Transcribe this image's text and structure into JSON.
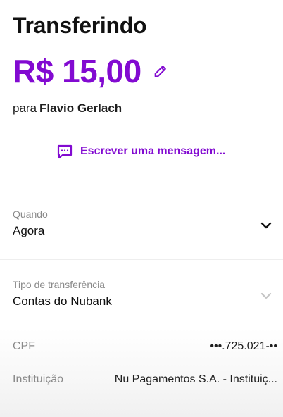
{
  "header": {
    "title": "Transferindo"
  },
  "transfer": {
    "amount": "R$ 15,00",
    "recipient_prefix": "para",
    "recipient_name": "Flavio Gerlach",
    "message_label": "Escrever uma mensagem..."
  },
  "when": {
    "label": "Quando",
    "value": "Agora"
  },
  "transfer_type": {
    "label": "Tipo de transferência",
    "value": "Contas do Nubank"
  },
  "details": {
    "cpf_label": "CPF",
    "cpf_value": "•••.725.021-••",
    "institution_label": "Instituição",
    "institution_value": "Nu Pagamentos S.A. - Instituiç..."
  },
  "icons": {
    "edit": "pencil-icon",
    "message": "chat-icon",
    "chevron": "chevron-down-icon"
  },
  "colors": {
    "accent": "#820ad1"
  }
}
